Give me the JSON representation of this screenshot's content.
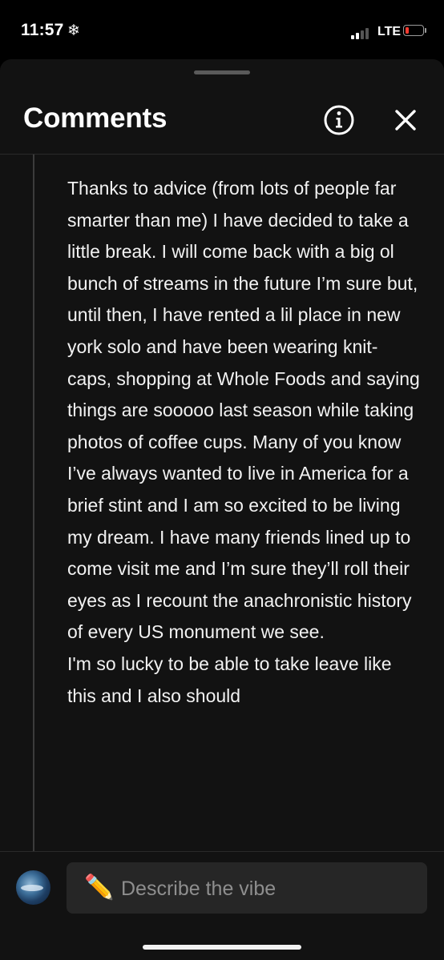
{
  "status_bar": {
    "time": "11:57",
    "time_icon": "snowflake-icon",
    "network": "LTE",
    "signal_bars_active": 2,
    "signal_bars_total": 4,
    "battery_level": 0.1,
    "battery_color": "#ff3b30"
  },
  "sheet": {
    "title": "Comments",
    "info_icon": "info-icon",
    "close_icon": "close-icon"
  },
  "comment": {
    "paragraphs": [
      "Thanks to advice (from lots of people far smarter than me) I have decided to take a little break. I will come back with a big ol bunch of streams in the future I’m sure but, until then, I have rented a lil place in new york solo and have been wearing knit-caps, shopping at Whole Foods and saying things are sooooo last season while taking photos of coffee cups. Many of you know I’ve always wanted to live in America for a brief stint and I am so excited to be living my dream. I have many friends lined up to come visit me and I’m sure they’ll roll their eyes as I recount the anachronistic history of every US monument we see.",
      "I'm so lucky to be able to take leave like this and I also should"
    ]
  },
  "input": {
    "emoji": "✏️",
    "placeholder": "Describe the vibe"
  },
  "colors": {
    "background": "#000000",
    "sheet": "#121212",
    "input_field": "#262626",
    "placeholder_text": "#8e8e8e"
  }
}
